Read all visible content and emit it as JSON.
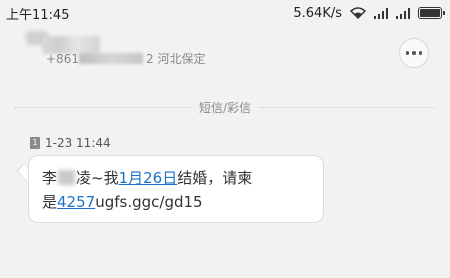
{
  "status_bar": {
    "time": "上午11:45",
    "network_speed": "5.64K/s",
    "icons": [
      "wifi-icon",
      "signal-icon",
      "signal-icon",
      "battery-icon"
    ]
  },
  "header": {
    "location": "河北保定",
    "number_prefix": "+861",
    "number_suffix": "2"
  },
  "divider": {
    "label": "短信/彩信"
  },
  "message": {
    "sim_label": "1",
    "timestamp": "1-23 11:44",
    "text_1": "李",
    "text_2": "凌~我",
    "link_date": "1月26日",
    "text_3": "结婚，请柬",
    "text_4": "是",
    "link_number": "4257",
    "text_5": "ugfs.ggc/gd15"
  }
}
